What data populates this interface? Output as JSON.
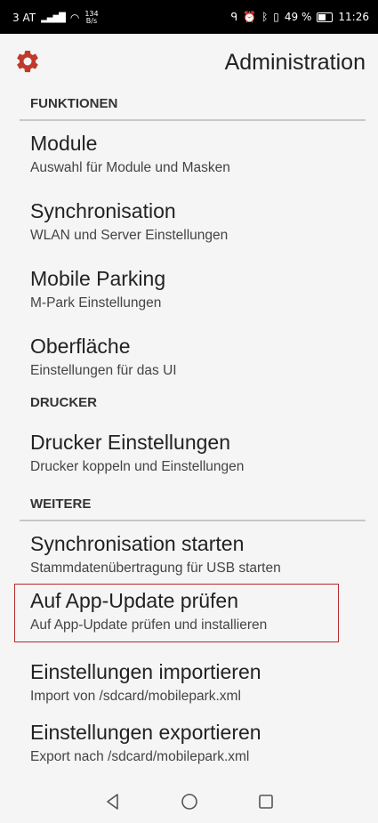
{
  "status_bar": {
    "carrier": "3 AT",
    "speed_value": "134",
    "speed_unit": "B/s",
    "battery_percent": "49 %",
    "time": "11:26"
  },
  "app_bar": {
    "title": "Administration",
    "icon": "gear-icon",
    "icon_color": "#c0392b"
  },
  "sections": [
    {
      "header": "FUNKTIONEN",
      "items": [
        {
          "title": "Module",
          "summary": "Auswahl für Module und Masken"
        },
        {
          "title": "Synchronisation",
          "summary": "WLAN und Server Einstellungen"
        },
        {
          "title": "Mobile Parking",
          "summary": "M-Park Einstellungen"
        },
        {
          "title": "Oberfläche",
          "summary": "Einstellungen für das UI"
        }
      ]
    },
    {
      "header": "DRUCKER",
      "items": [
        {
          "title": "Drucker Einstellungen",
          "summary": "Drucker koppeln und Einstellungen"
        }
      ]
    },
    {
      "header": "WEITERE",
      "items": [
        {
          "title": "Synchronisation starten",
          "summary": "Stammdatenübertragung für USB starten"
        },
        {
          "title": "Auf App-Update prüfen",
          "summary": "Auf App-Update prüfen und installieren",
          "highlighted": true
        },
        {
          "title": "Einstellungen importieren",
          "summary": "Import von /sdcard/mobilepark.xml"
        },
        {
          "title": "Einstellungen exportieren",
          "summary": "Export nach /sdcard/mobilepark.xml"
        }
      ]
    }
  ],
  "nav_bar": {
    "back": "back-icon",
    "home": "home-icon",
    "recents": "recents-icon"
  },
  "colors": {
    "highlight_border": "#b62a2a",
    "background": "#f5f5f5"
  }
}
